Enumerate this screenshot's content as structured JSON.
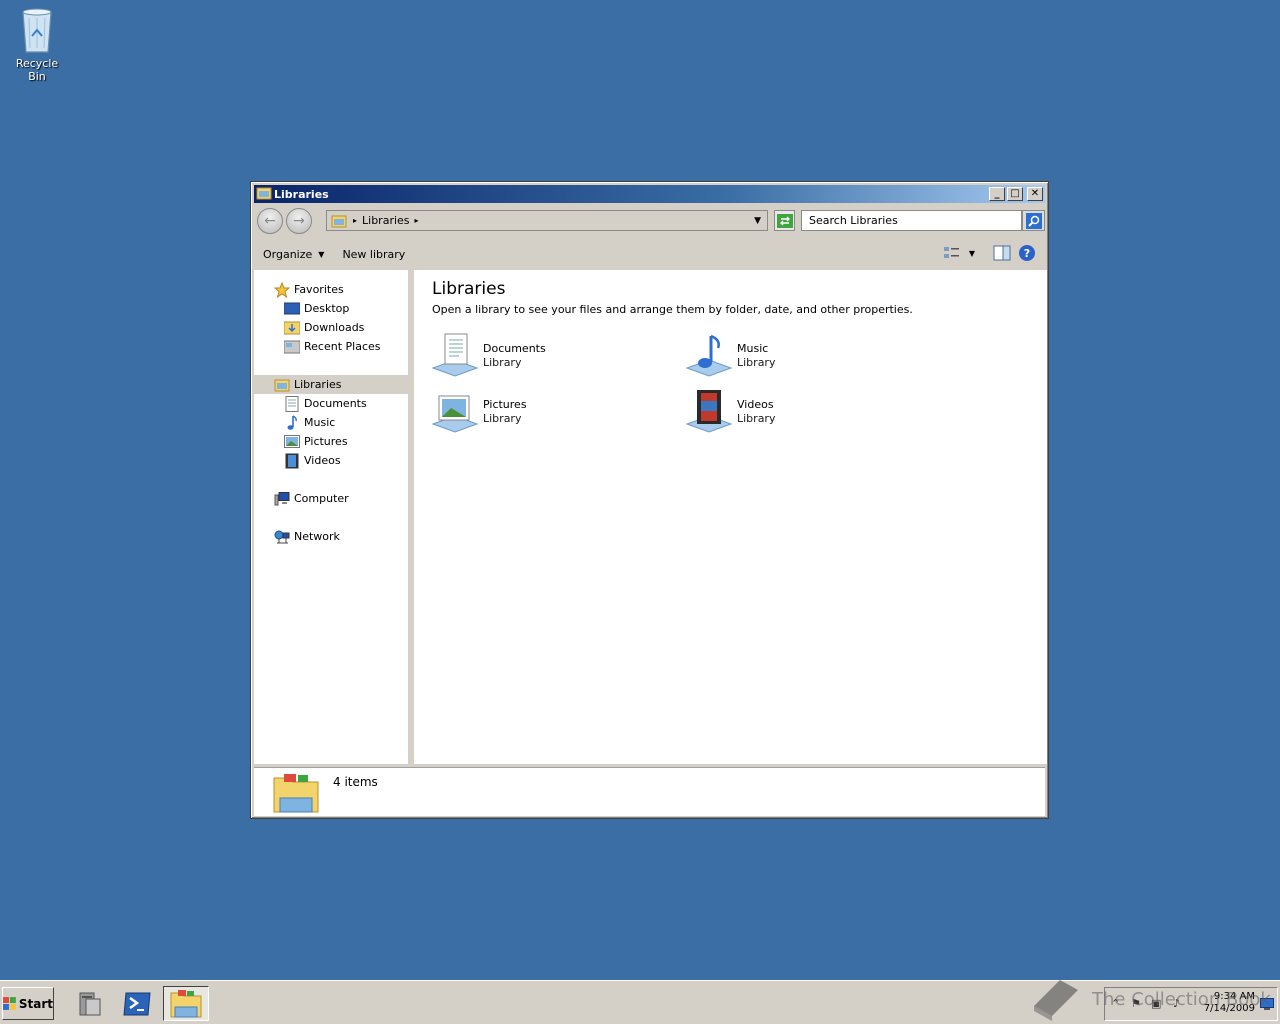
{
  "desktop": {
    "recycle_bin_label": "Recycle Bin",
    "background": "#3a6ea5"
  },
  "window": {
    "title": "Libraries",
    "controls": {
      "minimize_icon": "minimize-icon",
      "maximize_icon": "maximize-icon",
      "close_icon": "close-icon"
    },
    "address": {
      "crumb": "Libraries"
    },
    "search": {
      "placeholder": "Search Libraries"
    },
    "commands": {
      "organize": "Organize",
      "new_library": "New library"
    },
    "nav": {
      "favorites": {
        "label": "Favorites",
        "items": [
          "Desktop",
          "Downloads",
          "Recent Places"
        ]
      },
      "libraries": {
        "label": "Libraries",
        "items": [
          "Documents",
          "Music",
          "Pictures",
          "Videos"
        ]
      },
      "computer": "Computer",
      "network": "Network",
      "selected": "Libraries"
    },
    "content": {
      "heading": "Libraries",
      "subtitle": "Open a library to see your files and arrange them by folder, date, and other properties.",
      "libraries": [
        {
          "name": "Documents",
          "type": "Library",
          "icon": "documents-library-icon"
        },
        {
          "name": "Music",
          "type": "Library",
          "icon": "music-library-icon"
        },
        {
          "name": "Pictures",
          "type": "Library",
          "icon": "pictures-library-icon"
        },
        {
          "name": "Videos",
          "type": "Library",
          "icon": "videos-library-icon"
        }
      ]
    },
    "details": {
      "count": "4 items"
    }
  },
  "taskbar": {
    "start_label": "Start",
    "apps": [
      "server-manager-icon",
      "powershell-icon",
      "explorer-libraries-icon"
    ],
    "active_app": "explorer-libraries-icon",
    "clock": {
      "time": "9:34 AM",
      "date": "7/14/2009"
    }
  },
  "watermark": {
    "text": "The Collection Book"
  }
}
